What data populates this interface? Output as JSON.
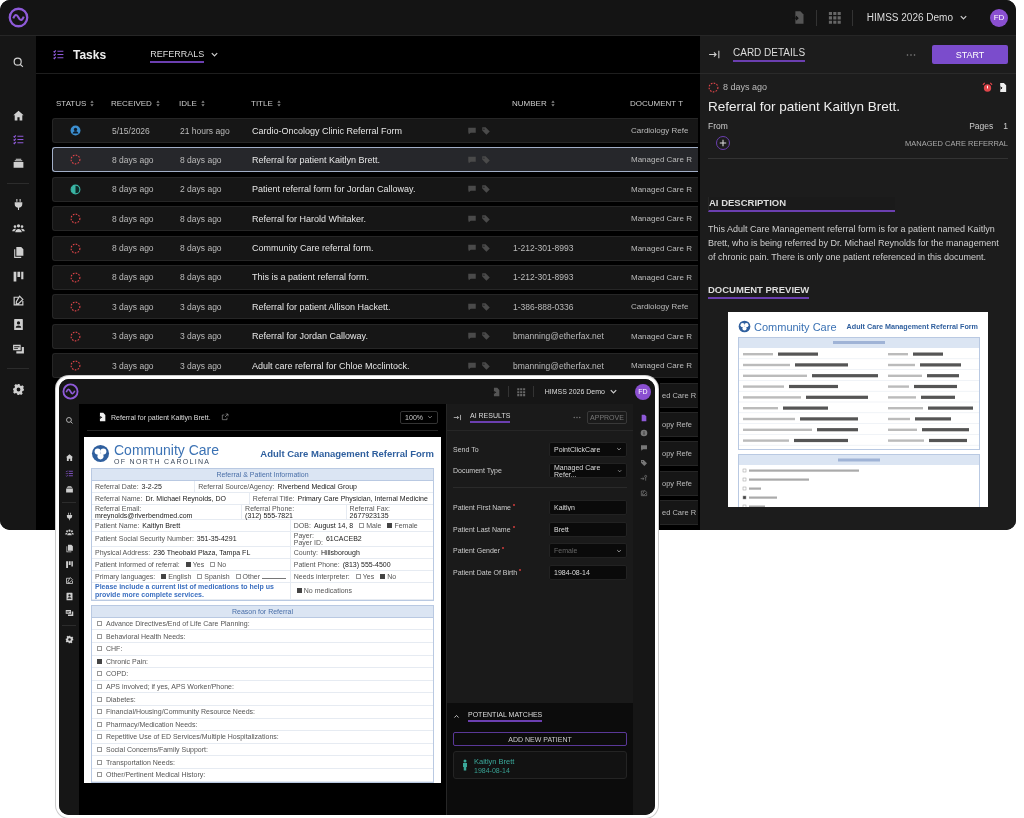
{
  "app": {
    "workspace": "HIMSS 2026 Demo",
    "user_initials": "FD"
  },
  "sidebar": {
    "items": [
      {
        "selected": false
      },
      {
        "selected": false
      },
      {
        "selected": true
      },
      {
        "selected": false
      },
      {
        "selected": false
      },
      {
        "selected": false
      },
      {
        "selected": false
      },
      {
        "selected": false
      },
      {
        "selected": false
      },
      {
        "selected": false
      },
      {
        "selected": false
      },
      {
        "selected": false
      }
    ]
  },
  "tasks": {
    "title": "Tasks",
    "view": "REFERRALS",
    "columns": [
      {
        "label": "STATUS",
        "sortable": true
      },
      {
        "label": "RECEIVED",
        "sortable": true
      },
      {
        "label": "IDLE",
        "sortable": true
      },
      {
        "label": "TITLE",
        "sortable": true
      },
      {
        "label": "NUMBER",
        "sortable": true
      },
      {
        "label": "DOCUMENT T",
        "sortable": false
      }
    ],
    "rows": [
      {
        "kind": "assigned",
        "received": "5/15/2026",
        "idle": "21 hours ago",
        "title": "Cardio-Oncology Clinic Referral Form",
        "document_type": "Cardiology Refe",
        "selected": false
      },
      {
        "kind": "new",
        "received": "8 days ago",
        "idle": "8 days ago",
        "title": "Referral for patient Kaitlyn Brett.",
        "document_type": "Managed Care R",
        "selected": true
      },
      {
        "kind": "in_progress",
        "received": "8 days ago",
        "idle": "2 days ago",
        "title": "Patient referral form for Jordan Calloway.",
        "document_type": "Managed Care R",
        "selected": false
      },
      {
        "kind": "new",
        "received": "8 days ago",
        "idle": "8 days ago",
        "title": "Referral for Harold Whitaker.",
        "document_type": "Managed Care R",
        "selected": false
      },
      {
        "kind": "new",
        "received": "8 days ago",
        "idle": "8 days ago",
        "title": "Community Care referral form.",
        "number": "1-212-301-8993",
        "document_type": "Managed Care R",
        "selected": false
      },
      {
        "kind": "new",
        "received": "8 days ago",
        "idle": "8 days ago",
        "title": "This is a patient referral form.",
        "number": "1-212-301-8993",
        "document_type": "Managed Care R",
        "selected": false
      },
      {
        "kind": "new",
        "received": "3 days ago",
        "idle": "3 days ago",
        "title": "Referral for patient Allison Hackett.",
        "number": "1-386-888-0336",
        "document_type": "Cardiology Refe",
        "selected": false
      },
      {
        "kind": "new",
        "received": "3 days ago",
        "idle": "3 days ago",
        "title": "Referral for Jordan Calloway.",
        "number": "bmanning@etherfax.net",
        "document_type": "Managed Care R",
        "selected": false
      },
      {
        "kind": "new",
        "received": "3 days ago",
        "idle": "3 days ago",
        "title": "Adult care referral for Chloe Mcclintock.",
        "number": "bmanning@etherfax.net",
        "document_type": "Managed Care R",
        "selected": false
      },
      {
        "kind": "partial",
        "document_type": "ed Care R",
        "selected": false
      },
      {
        "kind": "partial",
        "document_type": "opy Refe",
        "selected": false
      },
      {
        "kind": "partial",
        "document_type": "opy Refe",
        "selected": false
      },
      {
        "kind": "partial",
        "document_type": "opy Refe",
        "selected": false
      },
      {
        "kind": "partial",
        "document_type": "ed Care R",
        "selected": false
      }
    ]
  },
  "card_details": {
    "title": "CARD DETAILS",
    "action": "START",
    "kind": "new",
    "age": "8 days ago",
    "heading": "Referral for patient Kaitlyn Brett.",
    "from_label": "From",
    "pages_label": "Pages",
    "pages": "1",
    "document_type": "MANAGED CARE REFERRAL",
    "ai_description_title": "AI DESCRIPTION",
    "ai_description": "This Adult Care Management referral form is for a patient named Kaitlyn Brett, who is being referred by Dr. Michael Reynolds for the management of chronic pain. There is only one patient referenced in this document.",
    "preview_title": "DOCUMENT PREVIEW",
    "preview": {
      "org_name": "Community Care",
      "title": "Adult Care Management Referral Form"
    }
  },
  "viewer_window": {
    "workspace": "HIMSS 2026 Demo",
    "user_initials": "FD",
    "sidebar": {
      "items": [
        {
          "selected": false
        },
        {
          "selected": false
        },
        {
          "selected": true
        },
        {
          "selected": false
        },
        {
          "selected": false
        },
        {
          "selected": false
        },
        {
          "selected": false
        },
        {
          "selected": false
        },
        {
          "selected": false
        },
        {
          "selected": false
        },
        {
          "selected": false
        },
        {
          "selected": false
        }
      ]
    },
    "doc_title": "Referral for patient Kaitlyn Brett.",
    "zoom": "100%",
    "form": {
      "org_name": "Community Care",
      "org_sub": "OF NORTH CAROLINA",
      "title": "Adult Care Management Referral Form",
      "section_1": "Referral & Patient Information",
      "rows": [
        {
          "cells": [
            {
              "kind": "field",
              "label": "Referral Date:",
              "value": "3-2-25"
            },
            {
              "kind": "field",
              "label": "Referral Source/Agency:",
              "value": "Riverbend Medical Group"
            }
          ]
        },
        {
          "cells": [
            {
              "kind": "field",
              "label": "Referral Name:",
              "value": "Dr. Michael Reynolds, DO"
            },
            {
              "kind": "small_value",
              "label": "Referral Title:",
              "value": "Primary Care Physician, Internal Medicine"
            }
          ]
        },
        {
          "cells": [
            {
              "kind": "field",
              "label": "Referral Email:",
              "value": "mreynolds@riverbendmed.com"
            },
            {
              "kind": "field",
              "label": "Referral Phone:",
              "value": "(312) 555-7821"
            },
            {
              "kind": "field",
              "label": "Referral Fax:",
              "value": "2677923135"
            }
          ]
        },
        {
          "cells": [
            {
              "kind": "field",
              "label": "Patient Name:",
              "value": "Kaitlyn Brett"
            },
            {
              "kind": "field",
              "label": "DOB:",
              "value": "August 14, 8",
              "options": [
                {
                  "label": "Male",
                  "checked": false
                },
                {
                  "label": "Female",
                  "checked": true
                }
              ]
            }
          ]
        },
        {
          "cells": [
            {
              "kind": "field",
              "label": "Patient Social Security Number:",
              "value": "351-35-4291"
            },
            {
              "kind": "field",
              "label": "Payer:",
              "sublabel": "Payer ID:",
              "value": "61CACEB2"
            }
          ]
        },
        {
          "cells": [
            {
              "kind": "field",
              "label": "Physical Address:",
              "value": "236 Theobald Plaza, Tampa FL"
            },
            {
              "kind": "field",
              "label": "County:",
              "value": "Hillsborough"
            }
          ]
        },
        {
          "cells": [
            {
              "kind": "field",
              "label": "Patient informed of referral:",
              "options": [
                {
                  "label": "Yes",
                  "checked": true
                },
                {
                  "label": "No",
                  "checked": false
                }
              ]
            },
            {
              "kind": "field",
              "label": "Patient Phone:",
              "value": "(813) 555-4500"
            }
          ]
        },
        {
          "cells": [
            {
              "kind": "field",
              "label": "Primary languages:",
              "options": [
                {
                  "label": "English",
                  "checked": true
                },
                {
                  "label": "Spanish",
                  "checked": false
                },
                {
                  "label": "Other",
                  "checked": false,
                  "write_in": true
                }
              ]
            },
            {
              "kind": "field",
              "label": "Needs interpreter:",
              "options": [
                {
                  "label": "Yes",
                  "checked": false
                },
                {
                  "label": "No",
                  "checked": true
                }
              ]
            }
          ]
        },
        {
          "cells": [
            {
              "kind": "note",
              "text": "Please include a current list of medications to help us provide more complete services."
            },
            {
              "kind": "field",
              "options": [
                {
                  "label": "No medications",
                  "checked": true
                }
              ]
            }
          ]
        }
      ],
      "section_2": "Reason for Referral",
      "reasons": [
        {
          "label": "Advance Directives/End of Life Care Planning:",
          "checked": false
        },
        {
          "label": "Behavioral Health Needs:",
          "checked": false
        },
        {
          "label": "CHF:",
          "checked": false
        },
        {
          "label": "Chronic Pain:",
          "checked": true
        },
        {
          "label": "COPD:",
          "checked": false
        },
        {
          "label": "APS involved; if yes, APS Worker/Phone:",
          "checked": false
        },
        {
          "label": "Diabetes:",
          "checked": false
        },
        {
          "label": "Financial/Housing/Community Resource Needs:",
          "checked": false
        },
        {
          "label": "Pharmacy/Medication Needs:",
          "checked": false
        },
        {
          "label": "Repetitive Use of ED Services/Multiple Hospitalizations:",
          "checked": false
        },
        {
          "label": "Social Concerns/Family Support:",
          "checked": false
        },
        {
          "label": "Transportation Needs:",
          "checked": false
        },
        {
          "label": "Other/Pertinent Medical History:",
          "checked": false
        }
      ]
    },
    "ai_results": {
      "title": "AI RESULTS",
      "action": "APPROVE",
      "action_disabled": true,
      "fields": [
        {
          "kind": "select",
          "label": "Send To",
          "required": false,
          "value": "PointClickCare"
        },
        {
          "kind": "select",
          "label": "Document Type",
          "required": false,
          "value": "Managed Care Refer..."
        },
        {
          "kind": "text",
          "label": "Patient First Name",
          "required": true,
          "value": "Kaitlyn"
        },
        {
          "kind": "text",
          "label": "Patient Last Name",
          "required": true,
          "value": "Brett"
        },
        {
          "kind": "select",
          "label": "Patient Gender",
          "required": true,
          "placeholder": "Female"
        },
        {
          "kind": "text",
          "label": "Patient Date Of Birth",
          "required": true,
          "value": "1984-08-14"
        }
      ]
    },
    "potential_matches": {
      "title": "POTENTIAL MATCHES",
      "expanded": true,
      "add_label": "ADD NEW PATIENT",
      "matches": [
        {
          "name": "Kaitlyn Brett",
          "dob": "1984-08-14"
        }
      ]
    },
    "rail": {
      "items": [
        {
          "selected": true
        },
        {
          "selected": false
        },
        {
          "selected": false
        },
        {
          "selected": false
        },
        {
          "selected": false
        },
        {
          "selected": false
        }
      ]
    }
  }
}
